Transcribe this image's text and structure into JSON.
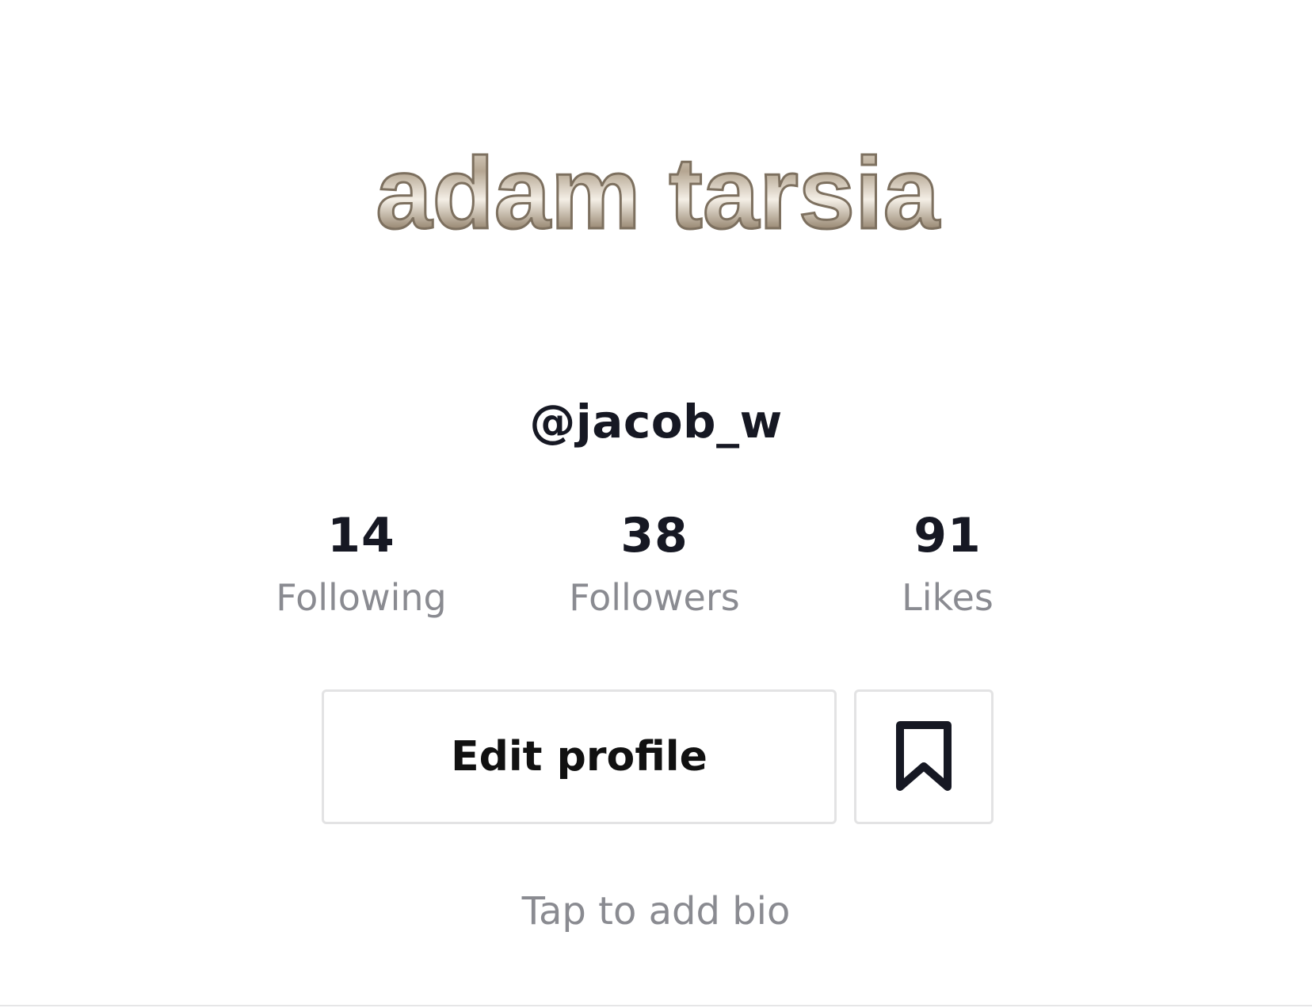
{
  "profile": {
    "avatar_text": "adam tarsia",
    "username": "@jacob_w",
    "bio_placeholder": "Tap to add bio"
  },
  "stats": {
    "following": {
      "value": "14",
      "label": "Following"
    },
    "followers": {
      "value": "38",
      "label": "Followers"
    },
    "likes": {
      "value": "91",
      "label": "Likes"
    }
  },
  "actions": {
    "edit_profile_label": "Edit profile",
    "bookmark_icon": "bookmark-icon"
  },
  "colors": {
    "text_primary": "#161823",
    "text_secondary": "#8a8b91",
    "border": "#e3e3e4",
    "metallic": "#b8aa98"
  }
}
